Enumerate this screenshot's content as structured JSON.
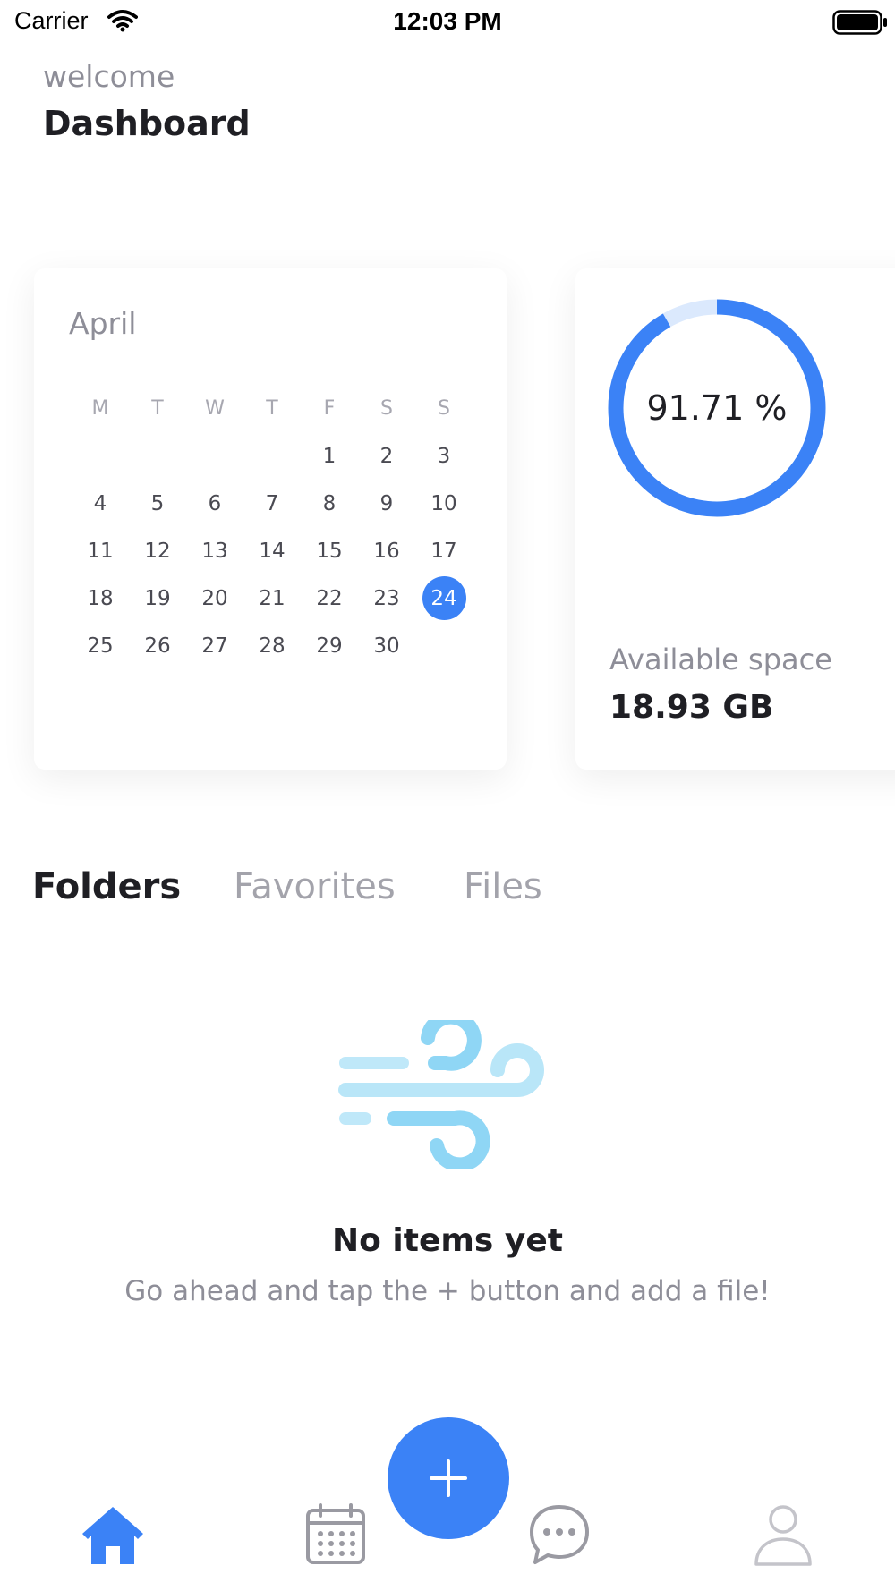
{
  "status_bar": {
    "carrier": "Carrier",
    "time": "12:03 PM"
  },
  "header": {
    "welcome": "welcome",
    "title": "Dashboard"
  },
  "calendar": {
    "month": "April",
    "weekdays": [
      "M",
      "T",
      "W",
      "T",
      "F",
      "S",
      "S"
    ],
    "leading_blanks": 4,
    "days": [
      "1",
      "2",
      "3",
      "4",
      "5",
      "6",
      "7",
      "8",
      "9",
      "10",
      "11",
      "12",
      "13",
      "14",
      "15",
      "16",
      "17",
      "18",
      "19",
      "20",
      "21",
      "22",
      "23",
      "24",
      "25",
      "26",
      "27",
      "28",
      "29",
      "30"
    ],
    "selected_day": "24"
  },
  "storage": {
    "percent_label": "91.71 %",
    "percent_value": 91.71,
    "available_label": "Available space",
    "available_value": "18.93 GB"
  },
  "tabs": [
    {
      "label": "Folders",
      "active": true
    },
    {
      "label": "Favorites",
      "active": false
    },
    {
      "label": "Files",
      "active": false
    }
  ],
  "empty_state": {
    "icon": "wind-icon",
    "title": "No items yet",
    "subtitle": "Go ahead and tap the + button and add a file!"
  },
  "tab_bar": {
    "items": [
      "home-icon",
      "calendar-icon",
      "chat-icon",
      "profile-icon"
    ],
    "fab_icon": "plus-icon"
  },
  "colors": {
    "accent": "#3b82f6",
    "accent_light": "#dbe9fd",
    "wind": "#a9e1f7"
  }
}
